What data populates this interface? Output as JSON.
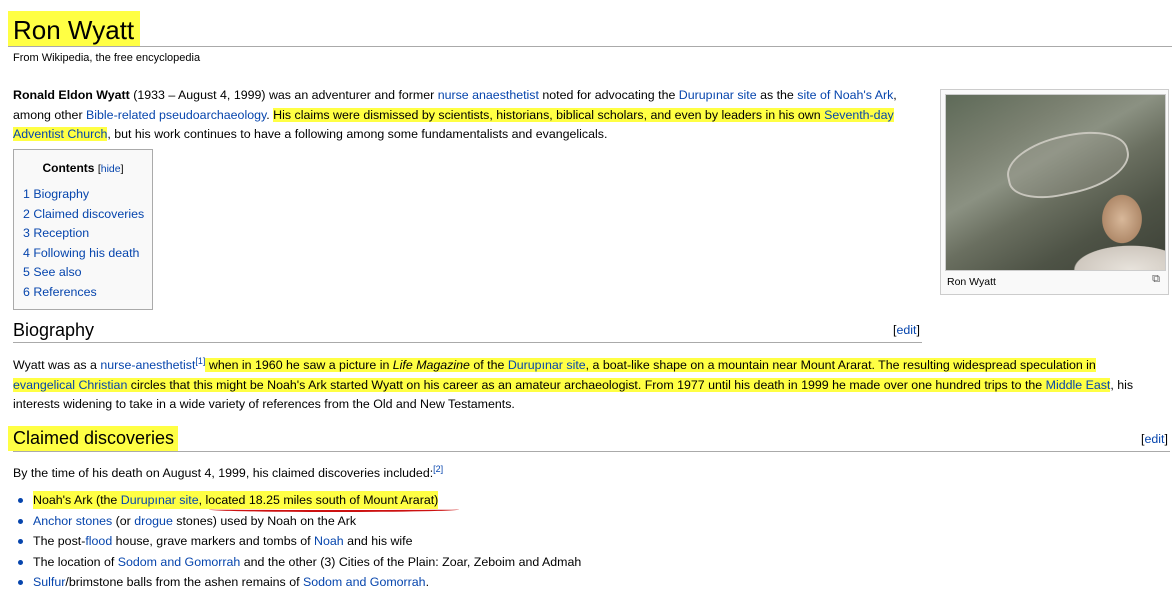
{
  "page": {
    "title": "Ron Wyatt",
    "subtitle": "From Wikipedia, the free encyclopedia"
  },
  "lead": {
    "name": "Ronald Eldon Wyatt",
    "t1": " (1933 – August 4, 1999) was an adventurer and former ",
    "l1": "nurse anaesthetist",
    "t2": " noted for advocating the ",
    "l2": "Durupınar site",
    "t3": " as the ",
    "l3": "site of Noah's Ark",
    "t4": ", among other ",
    "l4": "Bible-related pseudoarchaeology",
    "t5": ". ",
    "h1": "His claims were dismissed by scientists, historians, biblical scholars, and even by leaders in his own ",
    "hl1": "Seventh-day Adventist Church",
    "t6": ", but his work continues to have a following among some fundamentalists and evangelicals."
  },
  "toc": {
    "title": "Contents",
    "hide": "hide",
    "items": [
      "1 Biography",
      "2 Claimed discoveries",
      "3 Reception",
      "4 Following his death",
      "5 See also",
      "6 References"
    ]
  },
  "thumb": {
    "caption": "Ron Wyatt"
  },
  "biography": {
    "heading": "Biography",
    "edit": "edit",
    "t1": "Wyatt was as a ",
    "l1": "nurse-anesthetist",
    "ref1": "[1]",
    "h1": " when in 1960 he saw a picture in ",
    "hi1": "Life Magazine",
    "h2": " of the ",
    "hl1": "Durupınar site",
    "h3": ", a boat-like shape on a mountain near Mount Ararat. The resulting widespread speculation in ",
    "hl2": "evangelical Christian",
    "h4": " circles that this might be Noah's Ark started Wyatt on his career as an amateur archaeologist. From 1977 until his death in 1999 he made over one hundred trips to the ",
    "hl3": "Middle East",
    "t2": ", his interests widening to take in a wide variety of references from the Old and New Testaments."
  },
  "claimed": {
    "heading": "Claimed discoveries",
    "edit": "edit",
    "intro": "By the time of his death on August 4, 1999, his claimed discoveries included:",
    "ref2": "[2]",
    "b1": {
      "t1": "Noah's Ark (the ",
      "l1": "Durupınar site",
      "t2": ", located 18.25 miles south of Mount Ararat)"
    },
    "b2": {
      "l1": "Anchor stones",
      "t1": " (or ",
      "l2": "drogue",
      "t2": " stones) used by Noah on the Ark"
    },
    "b3": {
      "t1": "The post-",
      "l1": "flood",
      "t2": " house, grave markers and tombs of ",
      "l2": "Noah",
      "t3": " and his wife"
    },
    "b4": {
      "t1": "The location of ",
      "l1": "Sodom and Gomorrah",
      "t2": " and the other (3) Cities of the Plain: Zoar, Zeboim and Admah"
    },
    "b5": {
      "l1": "Sulfur",
      "t1": "/brimstone balls from the ashen remains of ",
      "l2": "Sodom and Gomorrah",
      "t2": "."
    }
  },
  "colors": {
    "highlight": "#ffff44",
    "link": "#0645ad",
    "underline": "#cc1111"
  }
}
